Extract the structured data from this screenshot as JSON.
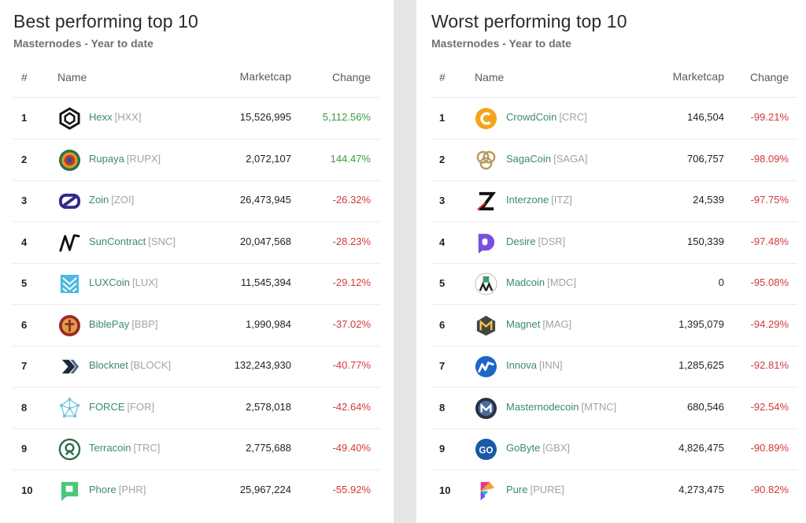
{
  "best": {
    "title": "Best performing top 10",
    "subtitle": "Masternodes - Year to date",
    "columns": {
      "rank": "#",
      "name": "Name",
      "marketcap": "Marketcap",
      "change": "Change"
    },
    "rows": [
      {
        "rank": "1",
        "name": "Hexx",
        "symbol": "[HXX]",
        "marketcap": "15,526,995",
        "change": "5,112.56%",
        "trend": "pos",
        "icon": "hexx-icon"
      },
      {
        "rank": "2",
        "name": "Rupaya",
        "symbol": "[RUPX]",
        "marketcap": "2,072,107",
        "change": "144.47%",
        "trend": "pos",
        "icon": "rupaya-icon"
      },
      {
        "rank": "3",
        "name": "Zoin",
        "symbol": "[ZOI]",
        "marketcap": "26,473,945",
        "change": "-26.32%",
        "trend": "neg",
        "icon": "zoin-icon"
      },
      {
        "rank": "4",
        "name": "SunContract",
        "symbol": "[SNC]",
        "marketcap": "20,047,568",
        "change": "-28.23%",
        "trend": "neg",
        "icon": "suncontract-icon"
      },
      {
        "rank": "5",
        "name": "LUXCoin",
        "symbol": "[LUX]",
        "marketcap": "11,545,394",
        "change": "-29.12%",
        "trend": "neg",
        "icon": "luxcoin-icon"
      },
      {
        "rank": "6",
        "name": "BiblePay",
        "symbol": "[BBP]",
        "marketcap": "1,990,984",
        "change": "-37.02%",
        "trend": "neg",
        "icon": "biblepay-icon"
      },
      {
        "rank": "7",
        "name": "Blocknet",
        "symbol": "[BLOCK]",
        "marketcap": "132,243,930",
        "change": "-40.77%",
        "trend": "neg",
        "icon": "blocknet-icon"
      },
      {
        "rank": "8",
        "name": "FORCE",
        "symbol": "[FOR]",
        "marketcap": "2,578,018",
        "change": "-42.64%",
        "trend": "neg",
        "icon": "force-icon"
      },
      {
        "rank": "9",
        "name": "Terracoin",
        "symbol": "[TRC]",
        "marketcap": "2,775,688",
        "change": "-49.40%",
        "trend": "neg",
        "icon": "terracoin-icon"
      },
      {
        "rank": "10",
        "name": "Phore",
        "symbol": "[PHR]",
        "marketcap": "25,967,224",
        "change": "-55.92%",
        "trend": "neg",
        "icon": "phore-icon"
      }
    ]
  },
  "worst": {
    "title": "Worst performing top 10",
    "subtitle": "Masternodes - Year to date",
    "columns": {
      "rank": "#",
      "name": "Name",
      "marketcap": "Marketcap",
      "change": "Change"
    },
    "rows": [
      {
        "rank": "1",
        "name": "CrowdCoin",
        "symbol": "[CRC]",
        "marketcap": "146,504",
        "change": "-99.21%",
        "trend": "neg",
        "icon": "crowdcoin-icon"
      },
      {
        "rank": "2",
        "name": "SagaCoin",
        "symbol": "[SAGA]",
        "marketcap": "706,757",
        "change": "-98.09%",
        "trend": "neg",
        "icon": "sagacoin-icon"
      },
      {
        "rank": "3",
        "name": "Interzone",
        "symbol": "[ITZ]",
        "marketcap": "24,539",
        "change": "-97.75%",
        "trend": "neg",
        "icon": "interzone-icon"
      },
      {
        "rank": "4",
        "name": "Desire",
        "symbol": "[DSR]",
        "marketcap": "150,339",
        "change": "-97.48%",
        "trend": "neg",
        "icon": "desire-icon"
      },
      {
        "rank": "5",
        "name": "Madcoin",
        "symbol": "[MDC]",
        "marketcap": "0",
        "change": "-95.08%",
        "trend": "neg",
        "icon": "madcoin-icon"
      },
      {
        "rank": "6",
        "name": "Magnet",
        "symbol": "[MAG]",
        "marketcap": "1,395,079",
        "change": "-94.29%",
        "trend": "neg",
        "icon": "magnet-icon"
      },
      {
        "rank": "7",
        "name": "Innova",
        "symbol": "[INN]",
        "marketcap": "1,285,625",
        "change": "-92.81%",
        "trend": "neg",
        "icon": "innova-icon"
      },
      {
        "rank": "8",
        "name": "Masternodecoin",
        "symbol": "[MTNC]",
        "marketcap": "680,546",
        "change": "-92.54%",
        "trend": "neg",
        "icon": "masternodecoin-icon"
      },
      {
        "rank": "9",
        "name": "GoByte",
        "symbol": "[GBX]",
        "marketcap": "4,826,475",
        "change": "-90.89%",
        "trend": "neg",
        "icon": "gobyte-icon"
      },
      {
        "rank": "10",
        "name": "Pure",
        "symbol": "[PURE]",
        "marketcap": "4,273,475",
        "change": "-90.82%",
        "trend": "neg",
        "icon": "pure-icon"
      }
    ]
  },
  "colors": {
    "link": "#3a8a6c",
    "symbol": "#a3a3a3",
    "positive": "#3c9a3c",
    "negative": "#d23a3a",
    "background": "#e6e6e6"
  }
}
